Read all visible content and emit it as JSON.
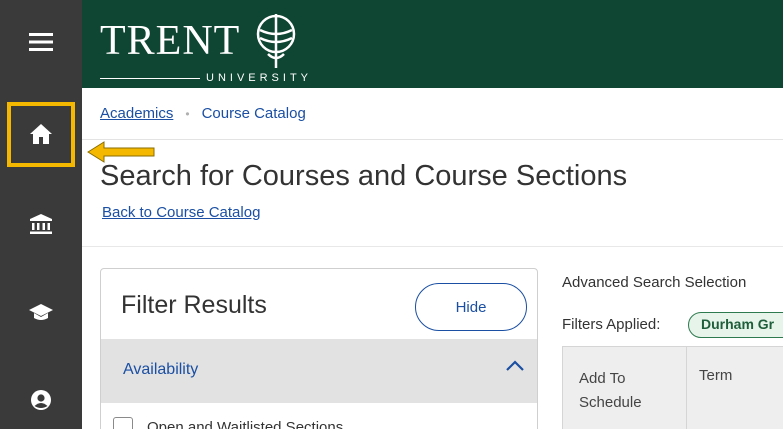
{
  "rail": {
    "icons": [
      "hamburger-menu-icon",
      "home-icon",
      "institution-icon",
      "graduation-cap-icon",
      "user-circle-icon"
    ]
  },
  "header": {
    "logo_main": "TRENT",
    "logo_sub": "UNIVERSITY"
  },
  "breadcrumb": {
    "items": [
      {
        "label": "Academics"
      },
      {
        "label": "Course Catalog"
      }
    ],
    "separator": "•"
  },
  "page": {
    "title": "Search for Courses and Course Sections",
    "back_link": "Back to Course Catalog"
  },
  "filter": {
    "title": "Filter Results",
    "hide_label": "Hide",
    "section_label": "Availability",
    "checkbox_label": "Open and Waitlisted Sections"
  },
  "results": {
    "advanced_search": "Advanced Search Selection",
    "filters_applied_label": "Filters Applied:",
    "filter_chip": "Durham Gr",
    "columns": [
      "Add To Schedule",
      "Term"
    ]
  },
  "colors": {
    "rail_bg": "#3a3a3a",
    "header_bg": "#0f4533",
    "link": "#1a4fa3",
    "highlight": "#f5b800"
  }
}
